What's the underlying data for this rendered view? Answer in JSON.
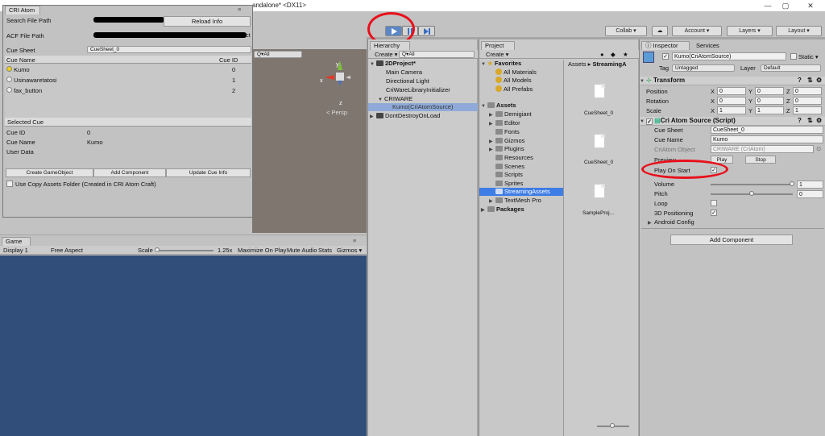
{
  "window": {
    "title": "andalone* <DX11>",
    "minimize": "—",
    "maximize": "▢",
    "close": "✕"
  },
  "toolbar": {
    "collab": "Collab ▾",
    "account": "Account ▾",
    "layers": "Layers ▾",
    "layout": "Layout ▾"
  },
  "cri_atom": {
    "tab": "CRI Atom",
    "search_file_path_label": "Search File Path",
    "reload_info": "Reload Info",
    "acf_file_path_label": "ACF File Path",
    "acf_tail": "ct",
    "cue_sheet_label": "Cue Sheet",
    "cue_sheet_value": "CueSheet_0",
    "col_cue_name": "Cue Name",
    "col_cue_id": "Cue ID",
    "cues": [
      {
        "name": "Kumo",
        "id": "0"
      },
      {
        "name": "Usinawaretatosi",
        "id": "1"
      },
      {
        "name": "fax_button",
        "id": "2"
      }
    ],
    "selected_cue_header": "Selected Cue",
    "cue_id_label": "Cue ID",
    "cue_id_value": "0",
    "cue_name_label": "Cue Name",
    "cue_name_value": "Kumo",
    "user_data_label": "User Data",
    "btn_create_gameobject": "Create GameObject",
    "btn_add_component": "Add Component",
    "btn_update_cue_info": "Update Cue Info",
    "use_copy_assets": "Use Copy Assets Folder (Created in CRI Atom Craft)"
  },
  "scene": {
    "search_placeholder": "Q▾All",
    "persp": "< Persp",
    "axis_y": "y",
    "axis_x": "x",
    "axis_z": "z"
  },
  "game": {
    "tab": "Game",
    "display": "Display 1",
    "aspect": "Free Aspect",
    "scale_label": "Scale",
    "scale_value": "1.25x",
    "maximize_on_play": "Maximize On Play",
    "mute_audio": "Mute Audio",
    "stats": "Stats",
    "gizmos": "Gizmos ▾"
  },
  "hierarchy": {
    "tab": "Hierarchy",
    "create": "Create ▾",
    "search": "Q▾All",
    "items": [
      {
        "label": "2DProject*"
      },
      {
        "label": "Main Camera"
      },
      {
        "label": "Directional Light"
      },
      {
        "label": "CriWareLibraryInitializer"
      },
      {
        "label": "CRIWARE"
      },
      {
        "label": "Kumo(CriAtomSource)"
      },
      {
        "label": "DontDestroyOnLoad"
      }
    ]
  },
  "project": {
    "tab": "Project",
    "create": "Create ▾",
    "favorites": "Favorites",
    "fav_items": [
      "All Materials",
      "All Models",
      "All Prefabs"
    ],
    "assets": "Assets",
    "asset_folders": [
      "Demigiant",
      "Editor",
      "Fonts",
      "Gizmos",
      "Plugins",
      "Resources",
      "Scenes",
      "Scripts",
      "Sprites",
      "StreamingAssets",
      "TextMesh Pro"
    ],
    "packages": "Packages",
    "breadcrumb": [
      "Assets",
      "StreamingA"
    ],
    "files": [
      "CueSheet_0",
      "CueSheet_0",
      "SampleProj..."
    ]
  },
  "inspector": {
    "tab_inspector": "Inspector",
    "tab_services": "Services",
    "object_name": "Kumo(CriAtomSource)",
    "static_label": "Static ▾",
    "tag_label": "Tag",
    "tag_value": "Untagged",
    "layer_label": "Layer",
    "layer_value": "Default",
    "transform": {
      "title": "Transform",
      "position_label": "Position",
      "position": {
        "x": "0",
        "y": "0",
        "z": "0"
      },
      "rotation_label": "Rotation",
      "rotation": {
        "x": "0",
        "y": "0",
        "z": "0"
      },
      "scale_label": "Scale",
      "scale": {
        "x": "1",
        "y": "1",
        "z": "1"
      }
    },
    "cri_source": {
      "title": "Cri Atom Source (Script)",
      "cue_sheet_label": "Cue Sheet",
      "cue_sheet_value": "CueSheet_0",
      "cue_name_label": "Cue Name",
      "cue_name_value": "Kumo",
      "atom_object_label": "CriAtom Object",
      "atom_object_value": "CRIWARE (CriAtom)",
      "preview_label": "Preview",
      "play": "Play",
      "stop": "Stop",
      "play_on_start_label": "Play On Start",
      "volume_label": "Volume",
      "volume_value": "1",
      "pitch_label": "Pitch",
      "pitch_value": "0",
      "loop_label": "Loop",
      "positioning_label": "3D Positioning",
      "android_config_label": "Android Config"
    },
    "add_component": "Add Component"
  },
  "colors": {
    "selection": "#3e7de5",
    "play_button": "#5b87c7",
    "annotation": "#e8101b",
    "game_view": "#314d79",
    "scene_view": "#7f7670"
  }
}
